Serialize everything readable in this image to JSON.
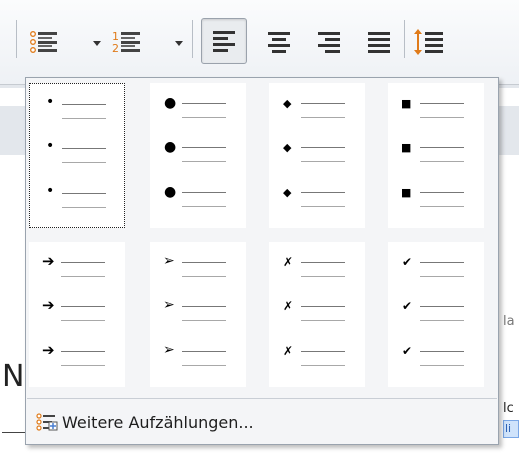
{
  "toolbar": {
    "buttons": [
      {
        "name": "bullet-list-button",
        "icon": "bullet-list-icon",
        "has_dropdown": true,
        "pressed": false
      },
      {
        "name": "numbered-list-button",
        "icon": "numbered-list-icon",
        "has_dropdown": true,
        "pressed": false
      },
      {
        "name": "align-left-button",
        "icon": "align-left-icon",
        "pressed": true
      },
      {
        "name": "align-center-button",
        "icon": "align-center-icon",
        "pressed": false
      },
      {
        "name": "align-right-button",
        "icon": "align-right-icon",
        "pressed": false
      },
      {
        "name": "justify-button",
        "icon": "justify-icon",
        "pressed": false
      },
      {
        "name": "line-spacing-button",
        "icon": "line-spacing-icon",
        "pressed": false
      }
    ],
    "numbered_icon_digits": [
      "1",
      "2"
    ]
  },
  "bullet_gallery": {
    "selected_index": 0,
    "styles": [
      {
        "name": "small-dot",
        "symbol": "•"
      },
      {
        "name": "large-dot",
        "symbol": "●"
      },
      {
        "name": "diamond",
        "symbol": "◆"
      },
      {
        "name": "square",
        "symbol": "■"
      },
      {
        "name": "arrow",
        "symbol": "➔"
      },
      {
        "name": "arrowhead",
        "symbol": "➢"
      },
      {
        "name": "cross",
        "symbol": "✗"
      },
      {
        "name": "check",
        "symbol": "✔"
      }
    ]
  },
  "more_bullets": {
    "label": "Weitere Aufzählungen...",
    "icon": "bullet-options-icon"
  },
  "document": {
    "heading_fragment": "N",
    "side_fragments": [
      "la",
      "lc",
      "li"
    ]
  },
  "colors": {
    "gallery_bg": "#f4f5f7",
    "cell_bg": "#ffffff",
    "accent_orange": "#e07b1a"
  }
}
